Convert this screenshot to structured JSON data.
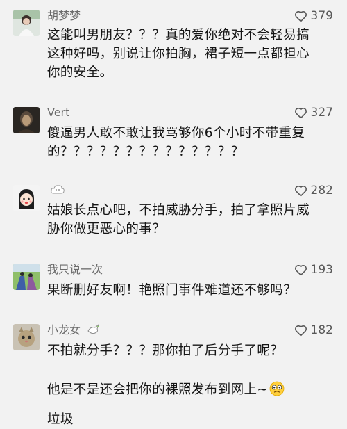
{
  "comments": [
    {
      "username": "胡梦梦",
      "likes": "379",
      "lines": [
        "这能叫男朋友？？？真的爱你绝对不会轻易搞",
        "这种好吗，别说让你拍胸，裙子短一点都担心",
        "你的安全。"
      ]
    },
    {
      "username": "Vert",
      "likes": "327",
      "lines": [
        "傻逼男人敢不敢让我骂够你6个小时不带重复",
        "的？？？？？？？？？？？？？？"
      ]
    },
    {
      "username": "",
      "username_icon": "cloud-sticker-icon",
      "likes": "282",
      "lines": [
        "姑娘长点心吧，不拍威胁分手，拍了拿照片威",
        "胁你做更恶心的事？"
      ]
    },
    {
      "username": "我只说一次",
      "likes": "193",
      "lines": [
        "果断删好友啊！艳照门事件难道还不够吗？"
      ]
    },
    {
      "username": "小龙女",
      "username_icon": "dove-icon",
      "likes": "182",
      "lines": [
        "不拍就分手？？？那你拍了后分手了呢？",
        "",
        "他是不是还会把你的裸照发布到网上~"
      ],
      "trailing_emoji": "wide-eyed-face-emoji",
      "cut_off_line": "垃圾"
    }
  ],
  "colors": {
    "background": "#f2f2f2",
    "username": "#6b6b6b",
    "text": "#151515",
    "likes": "#585858"
  }
}
